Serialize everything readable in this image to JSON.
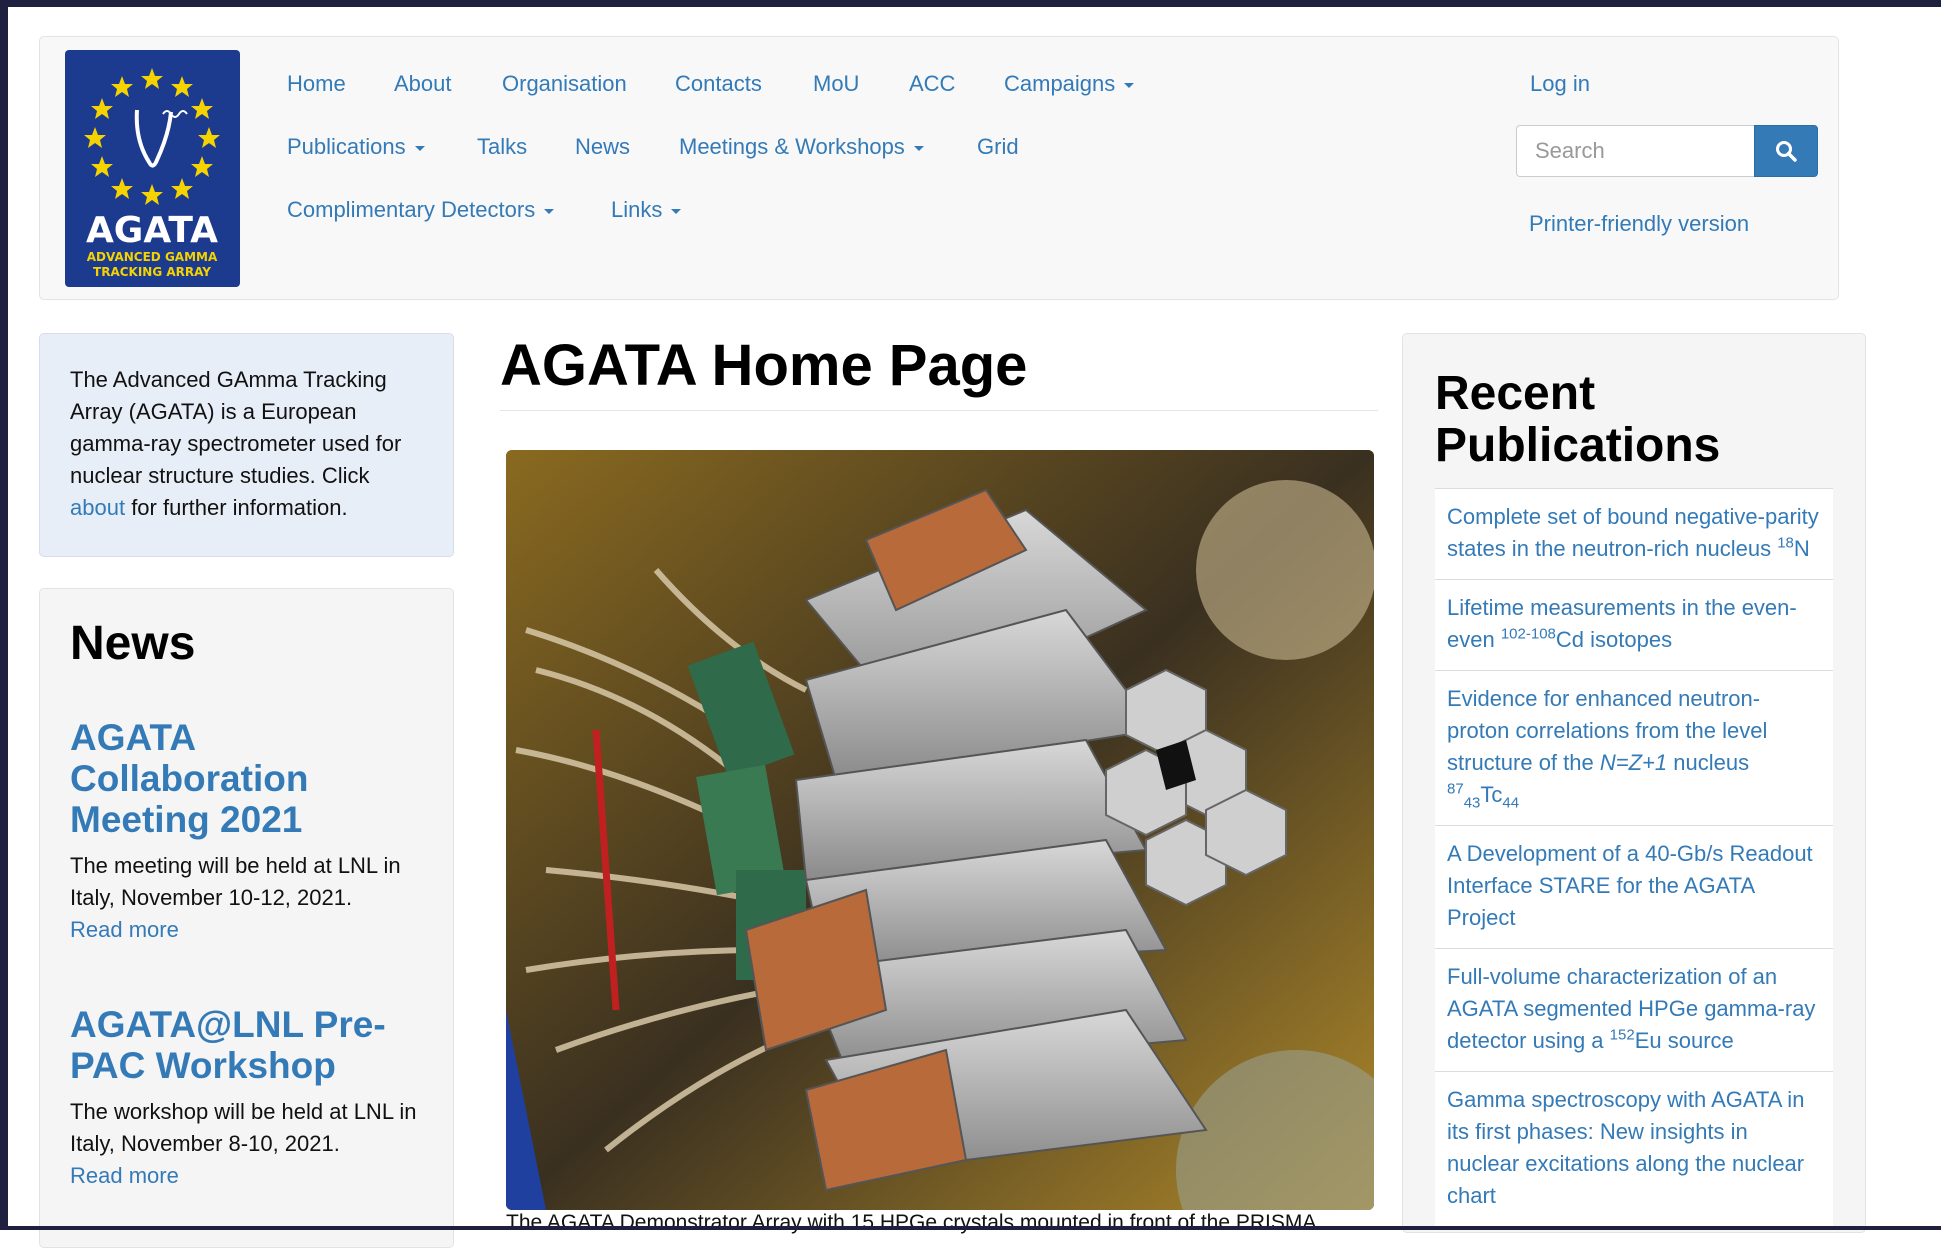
{
  "logo": {
    "name": "AGATA",
    "tagline_line1": "ADVANCED GAMMA",
    "tagline_line2": "TRACKING ARRAY",
    "colors": {
      "background": "#1c3a8e",
      "stars": "#f5d300",
      "text": "#ffffff"
    }
  },
  "nav": {
    "row1": [
      {
        "label": "Home"
      },
      {
        "label": "About"
      },
      {
        "label": "Organisation"
      },
      {
        "label": "Contacts"
      },
      {
        "label": "MoU"
      },
      {
        "label": "ACC"
      },
      {
        "label": "Campaigns",
        "dropdown": true
      }
    ],
    "row2": [
      {
        "label": "Publications",
        "dropdown": true
      },
      {
        "label": "Talks"
      },
      {
        "label": "News"
      },
      {
        "label": "Meetings & Workshops",
        "dropdown": true
      },
      {
        "label": "Grid"
      }
    ],
    "row3": [
      {
        "label": "Complimentary Detectors",
        "dropdown": true
      },
      {
        "label": "Links",
        "dropdown": true
      }
    ],
    "login": "Log in",
    "search_placeholder": "Search",
    "search_icon": "search-icon",
    "printer_friendly": "Printer-friendly version"
  },
  "intro": {
    "text": "The Advanced GAmma Tracking Array (AGATA) is a European gamma-ray spectrometer used for nuclear structure studies. Click",
    "link": "about",
    "text_after": "for further information."
  },
  "news": {
    "heading": "News",
    "items": [
      {
        "title": "AGATA Collaboration Meeting 2021",
        "body": "The meeting will be held at LNL in Italy, November 10-12, 2021.",
        "read_more": "Read more"
      },
      {
        "title": "AGATA@LNL Pre-PAC Workshop",
        "body": "The workshop will be held at LNL in Italy, November 8-10, 2021.",
        "read_more": "Read more"
      }
    ]
  },
  "main": {
    "title": "AGATA Home Page",
    "caption": "The AGATA Demonstrator Array with 15 HPGe crystals mounted in front of the PRISMA"
  },
  "publications": {
    "heading": "Recent Publications",
    "items": [
      {
        "parts": [
          {
            "t": "Complete set of bound negative-parity states in the neutron-rich nucleus "
          },
          {
            "t": "18",
            "sup": true
          },
          {
            "t": "N"
          }
        ]
      },
      {
        "parts": [
          {
            "t": "Lifetime measurements in the even-even "
          },
          {
            "t": "102-108",
            "sup": true
          },
          {
            "t": "Cd isotopes"
          }
        ]
      },
      {
        "parts": [
          {
            "t": "Evidence for enhanced neutron-proton correlations from the level structure of the "
          },
          {
            "t": "N=Z+1",
            "i": true
          },
          {
            "t": " nucleus "
          },
          {
            "t": "87",
            "sup": true
          },
          {
            "t": "43",
            "sub": true
          },
          {
            "t": "Tc"
          },
          {
            "t": "44",
            "sub": true
          }
        ]
      },
      {
        "parts": [
          {
            "t": "A Development of a 40-Gb/s Readout Interface STARE for the AGATA Project"
          }
        ]
      },
      {
        "parts": [
          {
            "t": "Full-volume characterization of an AGATA segmented HPGe gamma-ray detector using a "
          },
          {
            "t": "152",
            "sup": true
          },
          {
            "t": "Eu source"
          }
        ]
      },
      {
        "parts": [
          {
            "t": "Gamma spectroscopy with AGATA in its first phases: New insights in nuclear excitations along the nuclear chart"
          }
        ]
      }
    ]
  },
  "colors": {
    "link": "#337ab7",
    "accent": "#337ab7",
    "intro_bg": "#e8eef7"
  }
}
